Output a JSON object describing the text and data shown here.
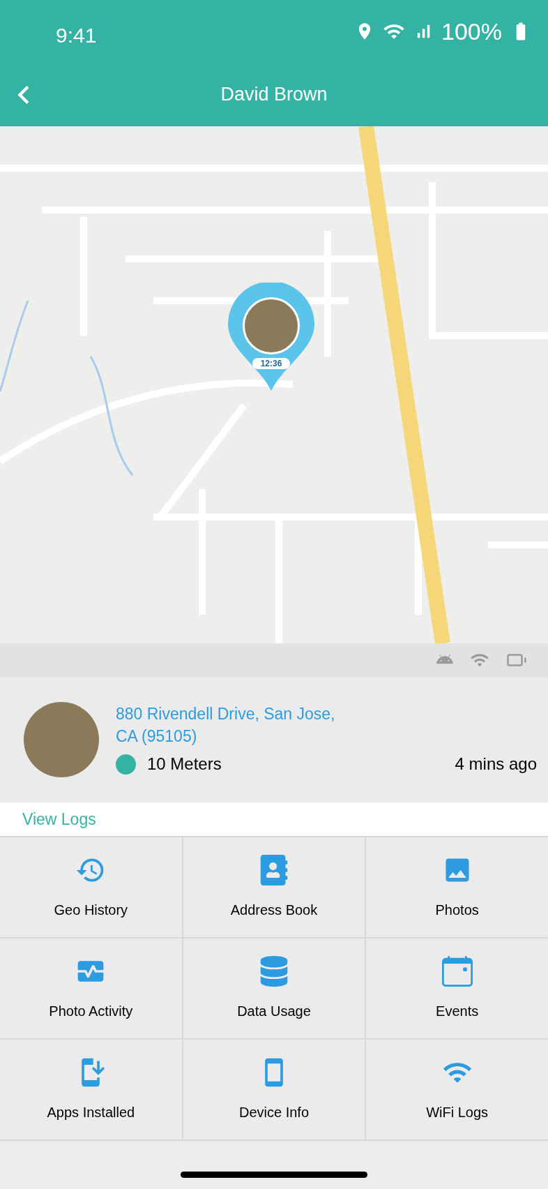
{
  "status_bar": {
    "time": "9:41",
    "battery": "100%"
  },
  "header": {
    "title": "David Brown"
  },
  "map": {
    "pin_time": "12:36"
  },
  "location": {
    "address": "880 Rivendell Drive, San Jose, CA (95105)",
    "accuracy": {
      "text": "10 Meters",
      "color": "#34b3a5"
    },
    "updated": "4 mins ago"
  },
  "view_logs": "View Logs",
  "features": [
    {
      "kind": "history",
      "label": "Geo History"
    },
    {
      "kind": "contacts",
      "label": "Address Book"
    },
    {
      "kind": "image",
      "label": "Photos"
    },
    {
      "kind": "monitor",
      "label": "Photo Activity"
    },
    {
      "kind": "database",
      "label": "Data Usage"
    },
    {
      "kind": "calendar",
      "label": "Events"
    },
    {
      "kind": "install",
      "label": "Apps Installed"
    },
    {
      "kind": "phone",
      "label": "Device Info"
    },
    {
      "kind": "wifi",
      "label": "WiFi Logs"
    }
  ]
}
